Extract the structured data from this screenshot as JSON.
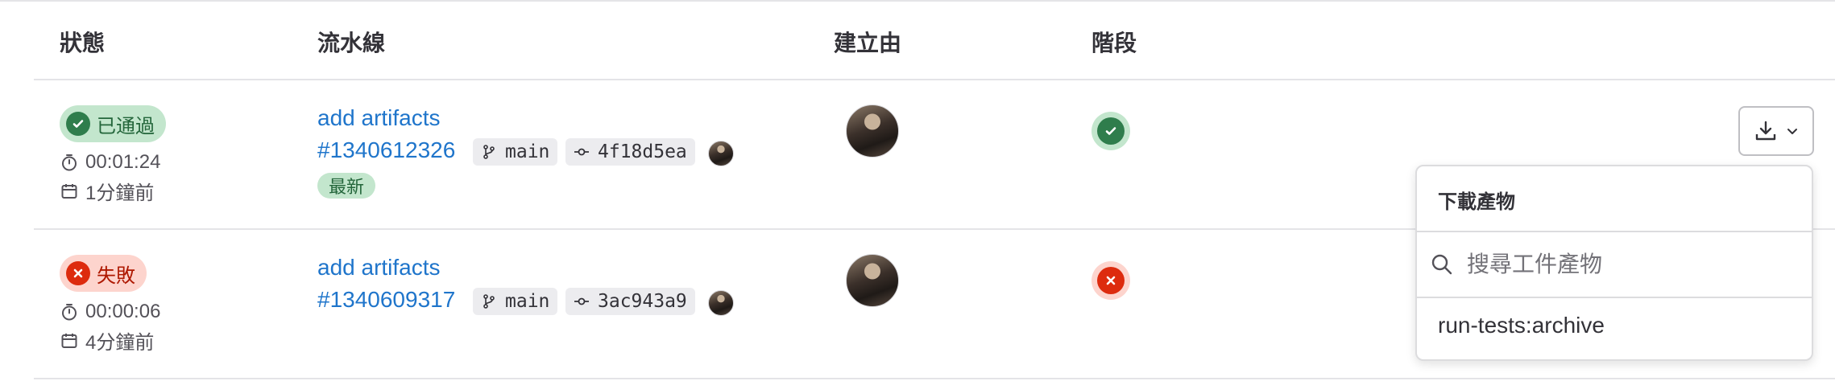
{
  "table": {
    "headers": {
      "status": "狀態",
      "pipeline": "流水線",
      "created_by": "建立由",
      "stages": "階段"
    }
  },
  "rows": [
    {
      "status_label": "已通過",
      "duration": "00:01:24",
      "time_ago": "1分鐘前",
      "commit_title": "add artifacts",
      "pipeline_id": "#1340612326",
      "branch": "main",
      "sha": "4f18d5ea",
      "tag": "最新"
    },
    {
      "status_label": "失敗",
      "duration": "00:00:06",
      "time_ago": "4分鐘前",
      "commit_title": "add artifacts",
      "pipeline_id": "#1340609317",
      "branch": "main",
      "sha": "3ac943a9"
    }
  ],
  "artifacts_dropdown": {
    "title": "下載產物",
    "search_placeholder": "搜尋工件產物",
    "items": [
      "run-tests:archive"
    ]
  },
  "colors": {
    "success": "#2f7d4c",
    "failed": "#dd2b0e",
    "link": "#1f75cb"
  }
}
